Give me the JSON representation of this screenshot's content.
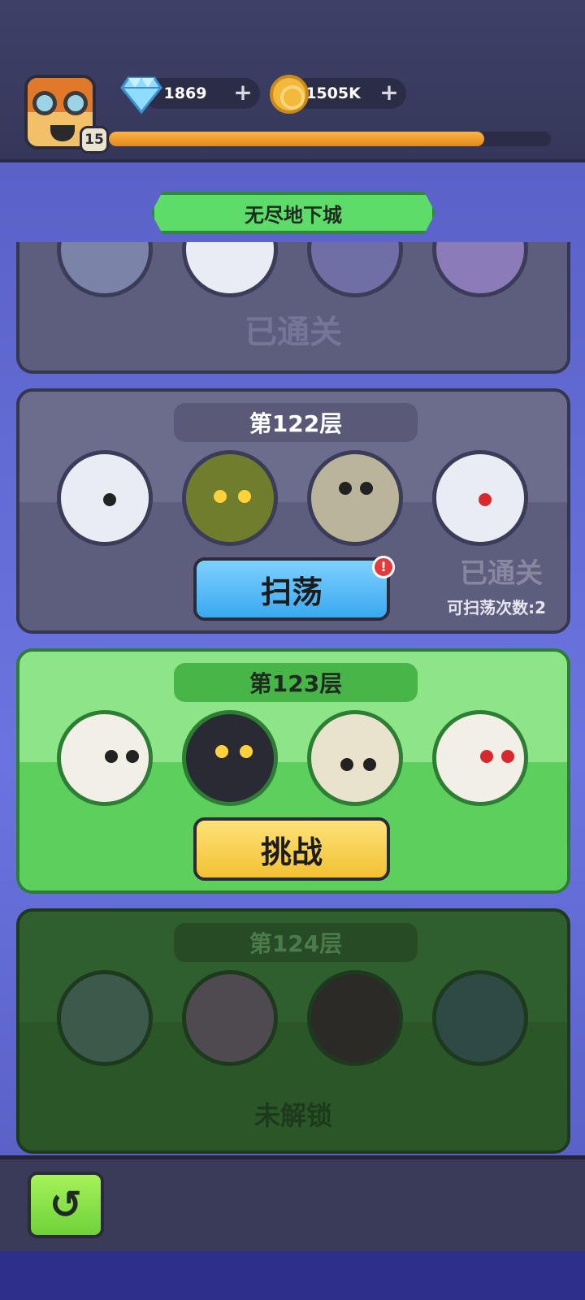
{
  "player": {
    "level": "15",
    "xp_progress": 0.85,
    "gems": "1869",
    "coins": "1505K"
  },
  "header": {
    "title": "无尽地下城"
  },
  "floors": [
    {
      "status": "已通关"
    },
    {
      "label": "第122层",
      "status": "已通关",
      "button": "扫荡",
      "alert": "!",
      "sweep_count": "可扫荡次数:2"
    },
    {
      "label": "第123层",
      "button": "挑战"
    },
    {
      "label": "第124层",
      "status": "未解锁"
    }
  ],
  "icons": {
    "gem": "diamond-icon",
    "coin": "coin-icon",
    "back": "back-arrow-icon",
    "add": "plus-icon"
  },
  "colors": {
    "accent_green": "#5ddc6a",
    "panel_gray": "#5d5d7e",
    "button_blue": "#3aa8ef",
    "button_yellow": "#f2c132"
  }
}
